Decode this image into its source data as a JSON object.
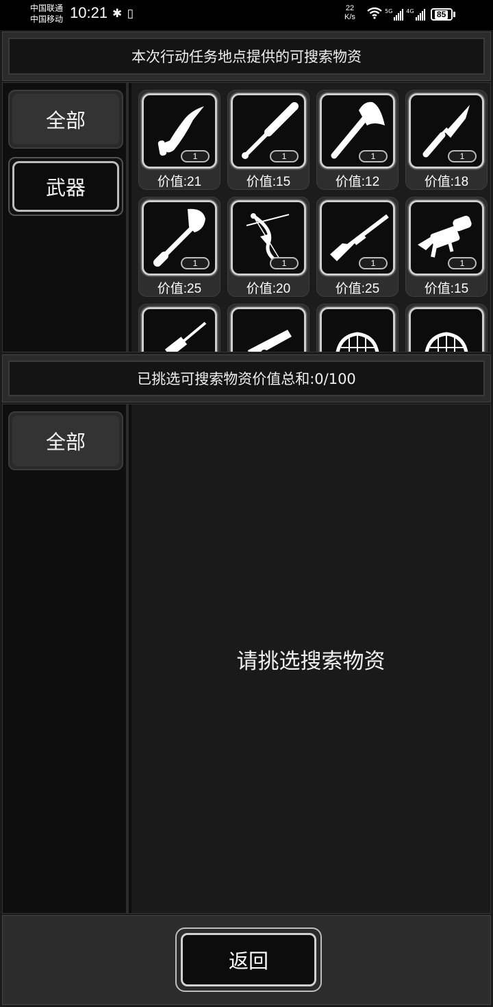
{
  "status_bar": {
    "carrier1": "中国联通",
    "carrier2": "中国移动",
    "time": "10:21",
    "left_icons": "✱ ▯",
    "net_speed_value": "22",
    "net_speed_unit": "K/s",
    "wifi_icon": "wifi-icon",
    "signal1_label": "5G",
    "signal2_label": "4G",
    "battery": "85"
  },
  "header": {
    "title": "本次行动任务地点提供的可搜索物资"
  },
  "top_categories": [
    {
      "label": "全部",
      "active": false
    },
    {
      "label": "武器",
      "active": true
    }
  ],
  "items": [
    {
      "icon": "machete-icon",
      "qty": "1",
      "value": "价值:21"
    },
    {
      "icon": "baseball-bat-icon",
      "qty": "1",
      "value": "价值:15"
    },
    {
      "icon": "axe-icon",
      "qty": "1",
      "value": "价值:12"
    },
    {
      "icon": "combat-knife-icon",
      "qty": "1",
      "value": "价值:18"
    },
    {
      "icon": "shovel-icon",
      "qty": "1",
      "value": "价值:25"
    },
    {
      "icon": "compound-bow-icon",
      "qty": "1",
      "value": "价值:20"
    },
    {
      "icon": "shotgun-icon",
      "qty": "1",
      "value": "价值:25"
    },
    {
      "icon": "grenade-launcher-icon",
      "qty": "1",
      "value": "价值:15"
    },
    {
      "icon": "rifle-icon",
      "qty": "",
      "value": ""
    },
    {
      "icon": "pistol-icon",
      "qty": "",
      "value": ""
    },
    {
      "icon": "helmet-icon",
      "qty": "",
      "value": ""
    },
    {
      "icon": "helmet-icon",
      "qty": "",
      "value": ""
    }
  ],
  "selected_bar": {
    "text": "已挑选可搜索物资价值总和:0/100"
  },
  "bottom_categories": [
    {
      "label": "全部"
    }
  ],
  "empty_message": "请挑选搜索物资",
  "footer": {
    "back_label": "返回"
  }
}
